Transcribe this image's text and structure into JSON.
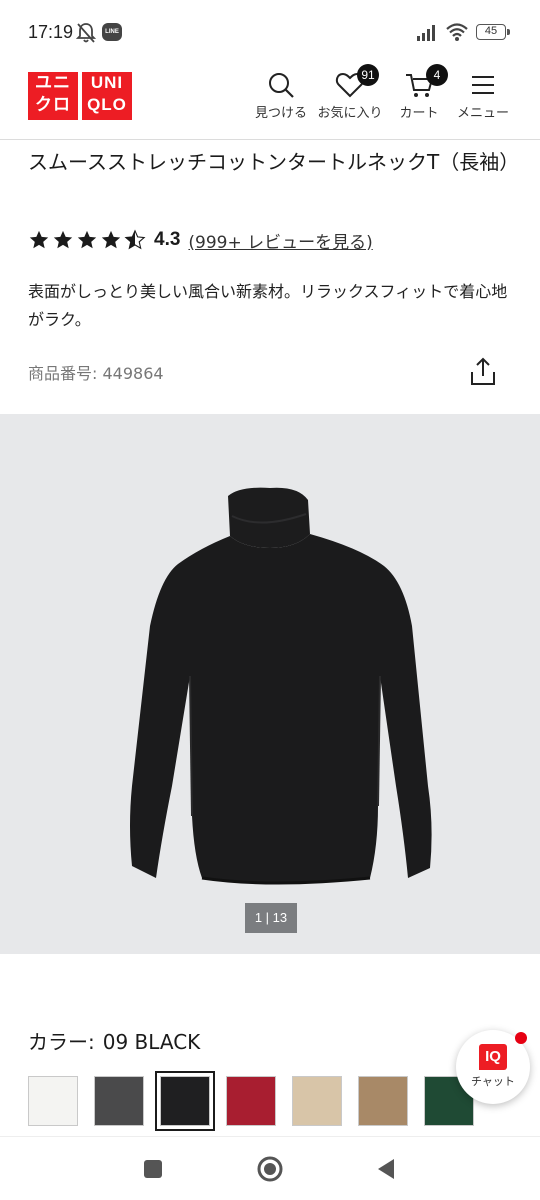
{
  "status_bar": {
    "time": "17:19",
    "line_app": "LINE",
    "battery": "45"
  },
  "header": {
    "logo_top_left": "ユニ",
    "logo_bottom_left": "クロ",
    "logo_top_right": "UNI",
    "logo_bottom_right": "QLO",
    "search_label": "見つける",
    "favorites_label": "お気に入り",
    "favorites_count": "91",
    "cart_label": "カート",
    "cart_count": "4",
    "menu_label": "メニュー",
    "brand_color": "#ed1d24"
  },
  "product": {
    "title": "スムースストレッチコットンタートルネックT（長袖）",
    "rating_value": "4.3",
    "rating_stars": 4.3,
    "reviews_link": "(999+ レビューを見る)",
    "description": "表面がしっとり美しい風合い新素材。リラックスフィットで着心地がラク。",
    "product_number_label": "商品番号: 449864"
  },
  "gallery": {
    "pager": "1 | 13",
    "background_color": "#e7e8ea"
  },
  "color_selector": {
    "label": "カラー:",
    "selected": "09 BLACK",
    "swatches": [
      {
        "color": "#f4f4f2"
      },
      {
        "color": "#4a4a4b"
      },
      {
        "color": "#1f1f21"
      },
      {
        "color": "#a81e30"
      },
      {
        "color": "#d8c5a8"
      },
      {
        "color": "#a88967"
      },
      {
        "color": "#1f4a34"
      }
    ]
  },
  "chat": {
    "badge_text": "IQ",
    "label": "チャット"
  },
  "icons": [
    "bell-mute-icon",
    "signal-icon",
    "wifi-icon",
    "battery-icon",
    "search-icon",
    "heart-icon",
    "cart-icon",
    "menu-icon",
    "star-icon",
    "share-icon",
    "square-icon",
    "home-circle-icon",
    "back-triangle-icon"
  ]
}
